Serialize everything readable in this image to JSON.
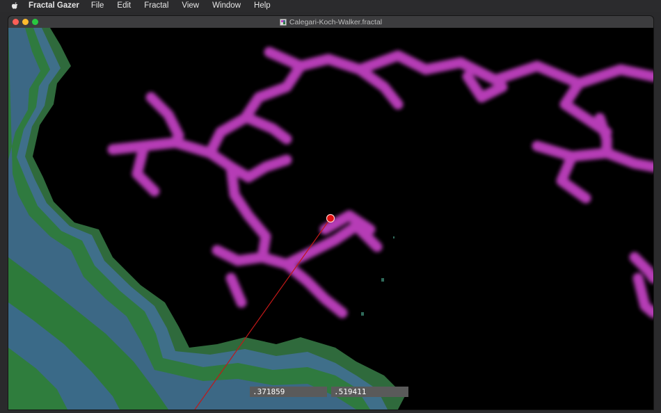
{
  "menubar": {
    "app_name": "Fractal Gazer",
    "items": [
      "File",
      "Edit",
      "Fractal",
      "View",
      "Window",
      "Help"
    ]
  },
  "window": {
    "title": "Calegari-Koch-Walker.fractal"
  },
  "coordinates": {
    "x_value": ".371859",
    "y_value": ".519411"
  },
  "colors": {
    "fractal_magenta": "#c040c0",
    "marker_red": "#e01010",
    "terrain_teal": "#3f6f8a",
    "terrain_green": "#2f7a3f"
  }
}
